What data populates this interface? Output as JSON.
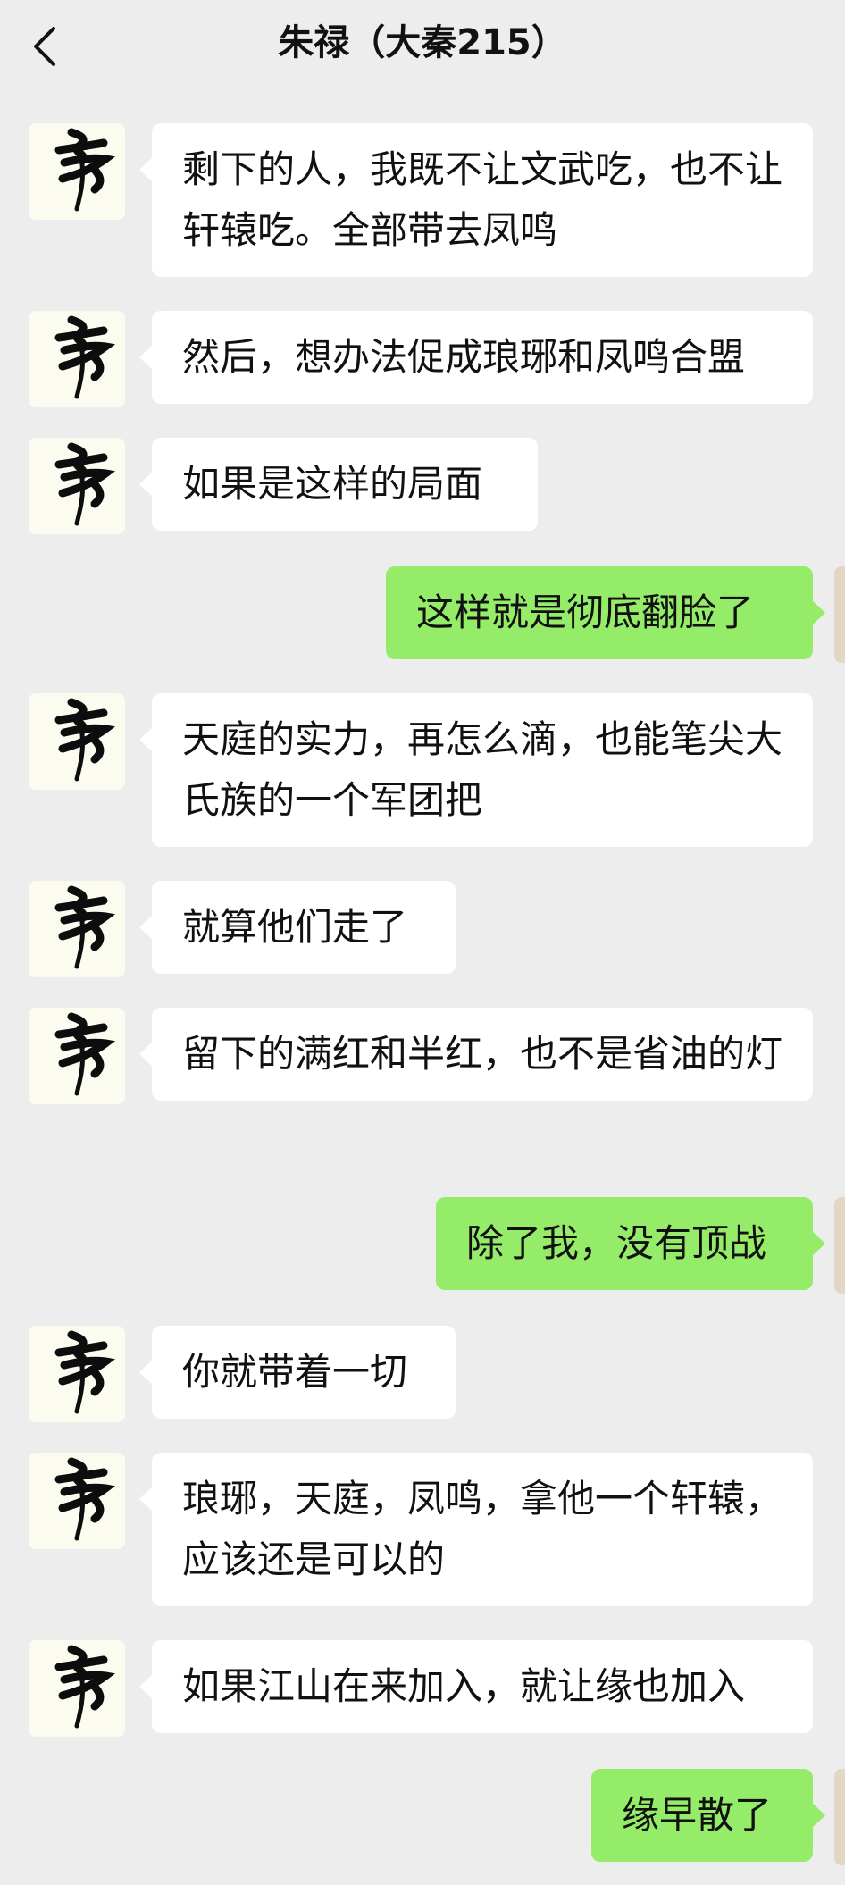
{
  "header": {
    "title": "朱禄（大秦215）",
    "back_icon": "chevron-left-icon"
  },
  "colors": {
    "background": "#ededed",
    "bubble_incoming": "#ffffff",
    "bubble_outgoing": "#95ec69"
  },
  "messages": [
    {
      "side": "left",
      "text": "剩下的人，我既不让文武吃，也不让轩辕吃。全部带去凤鸣"
    },
    {
      "side": "left",
      "text": "然后，想办法促成琅琊和凤鸣合盟"
    },
    {
      "side": "left",
      "text": "如果是这样的局面"
    },
    {
      "side": "right",
      "text": "这样就是彻底翻脸了"
    },
    {
      "side": "left",
      "text": "天庭的实力，再怎么滴，也能笔尖大氏族的一个军团把"
    },
    {
      "side": "left",
      "text": "就算他们走了"
    },
    {
      "side": "left",
      "text": "留下的满红和半红，也不是省油的灯"
    },
    {
      "side": "right",
      "text": "除了我，没有顶战"
    },
    {
      "side": "left",
      "text": "你就带着一切"
    },
    {
      "side": "left",
      "text": "琅琊，天庭，凤鸣，拿他一个轩辕，应该还是可以的"
    },
    {
      "side": "left",
      "text": "如果江山在来加入，就让缘也加入"
    },
    {
      "side": "right",
      "text": "缘早散了"
    }
  ]
}
